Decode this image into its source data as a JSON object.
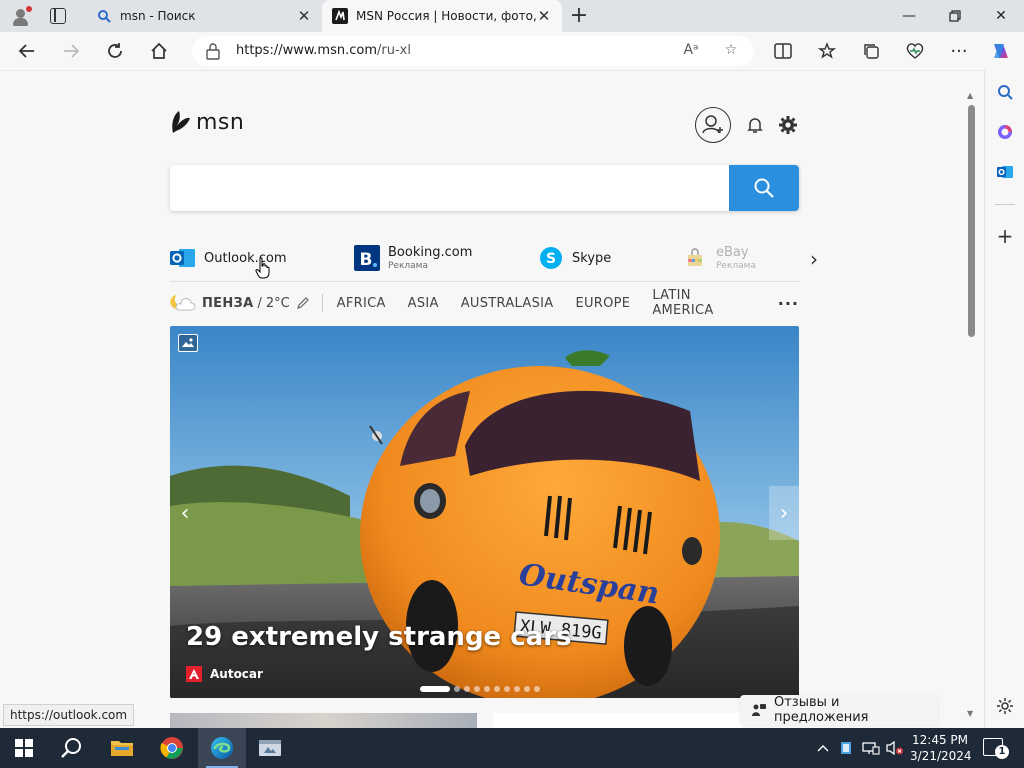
{
  "browser": {
    "tabs": [
      {
        "title": "msn - Поиск",
        "icon": "search-icon"
      },
      {
        "title": "MSN Россия | Новости, фото, п",
        "icon": "msn-icon"
      }
    ],
    "address": {
      "url_host": "https://www.msn.com",
      "url_path": "/ru-xl"
    },
    "status_url": "https://outlook.com"
  },
  "page": {
    "logo_text": "msn",
    "search": {
      "placeholder": "",
      "value": ""
    },
    "quicklinks": [
      {
        "name": "Outlook.com",
        "ad": ""
      },
      {
        "name": "Booking.com",
        "ad": "Реклама"
      },
      {
        "name": "Skype",
        "ad": ""
      },
      {
        "name": "eBay",
        "ad": "Реклама"
      }
    ],
    "weather": {
      "city": "ПЕНЗА",
      "sep": "/",
      "temp": "2°C"
    },
    "topics": [
      "AFRICA",
      "ASIA",
      "AUSTRALASIA",
      "EUROPE",
      "LATIN AMERICA"
    ],
    "topics_more": "···",
    "hero": {
      "headline": "29 extremely strange cars",
      "source": "Autocar",
      "plate": "XLW 819G",
      "brand": "Outspan",
      "slides_total": 10,
      "slide_active": 1
    },
    "feedback": "Отзывы и предложения"
  },
  "taskbar": {
    "time": "12:45 PM",
    "date": "3/21/2024",
    "notifications": "1"
  },
  "colors": {
    "accent": "#2b8fe0",
    "taskbar": "#1f2a38",
    "orange_car": "#f08a1e"
  }
}
